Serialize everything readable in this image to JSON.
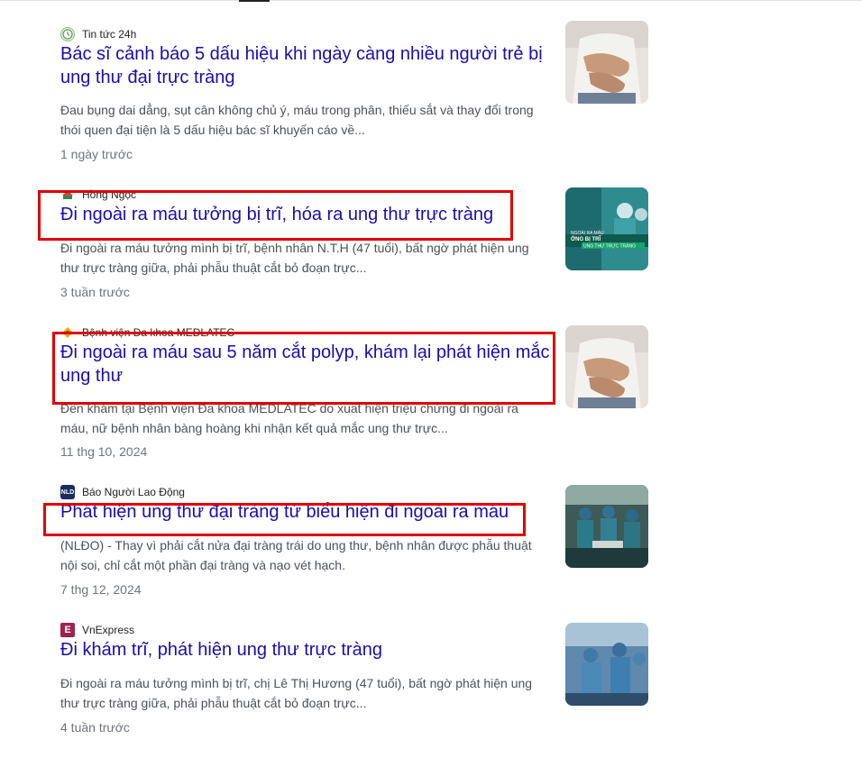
{
  "results": [
    {
      "source": "Tin tức 24h",
      "title": "Bác sĩ cảnh báo 5 dấu hiệu khi ngày càng nhiều người trẻ bị ung thư đại trực tràng",
      "snippet": "Đau bụng dai dẳng, sụt cân không chủ ý, máu trong phân, thiếu sắt và thay đổi trong thói quen đại tiện là 5 dấu hiệu bác sĩ khuyến cáo về...",
      "date": "1 ngày trước",
      "favicon_icon": "clock-logo-icon",
      "thumbnail": "abdominal-pain-thumbnail"
    },
    {
      "source": "Hồng Ngọc",
      "title": "Đi ngoài ra máu tưởng bị trĩ, hóa ra ung thư trực tràng",
      "snippet": "Đi ngoài ra máu tưởng mình bị trĩ, bệnh nhân N.T.H (47 tuổi), bất ngờ phát hiện ung thư trực tràng giữa, phải phẫu thuật cắt bỏ đoạn trực...",
      "date": "3 tuần trước",
      "favicon_icon": "hong-ngoc-logo-icon",
      "thumbnail": "surgery-banner-thumbnail",
      "thumbnail_text": [
        "NGOÀI RA MÁU",
        "ỞNG BỊ TRĨ",
        "UNG THƯ TRỰC TRÀNG"
      ],
      "highlighted": true
    },
    {
      "source": "Bệnh viện Đa khoa MEDLATEC",
      "title": "Đi ngoài ra máu sau 5 năm cắt polyp, khám lại phát hiện mắc ung thư",
      "snippet": "Đến khám tại Bệnh viện Đa khoa MEDLATEC do xuất hiện triệu chứng đi ngoài ra máu, nữ bệnh nhân bàng hoàng khi nhận kết quả mắc ung thư trực...",
      "date": "11 thg 10, 2024",
      "favicon_icon": "medlatec-logo-icon",
      "thumbnail": "abdominal-pain-thumbnail",
      "highlighted": true
    },
    {
      "source": "Báo Người Lao Động",
      "title": "Phát hiện ung thư đại tràng từ biểu hiện đi ngoài ra máu",
      "snippet": "(NLĐO) - Thay vì phải cắt nửa đại tràng trái do ung thư, bệnh nhân được phẫu thuật nội soi, chỉ cắt một phần đại tràng và nạo vét hạch.",
      "date": "7 thg 12, 2024",
      "favicon_icon": "nld-logo-icon",
      "favicon_text": "NLD",
      "thumbnail": "operating-room-thumbnail",
      "highlighted": true
    },
    {
      "source": "VnExpress",
      "title": "Đi khám trĩ, phát hiện ung thư trực tràng",
      "snippet": "Đi ngoài ra máu tưởng mình bị trĩ, chị Lê Thị Hương (47 tuổi), bất ngờ phát hiện ung thư trực tràng giữa, phải phẫu thuật cắt bỏ đoạn trực...",
      "date": "4 tuần trước",
      "favicon_icon": "vnexpress-logo-icon",
      "favicon_text": "E",
      "thumbnail": "surgery-team-thumbnail"
    }
  ],
  "colors": {
    "title_link": "#1a0dab",
    "snippet": "#4d5156",
    "date": "#70757a",
    "highlight": "#e00000"
  }
}
